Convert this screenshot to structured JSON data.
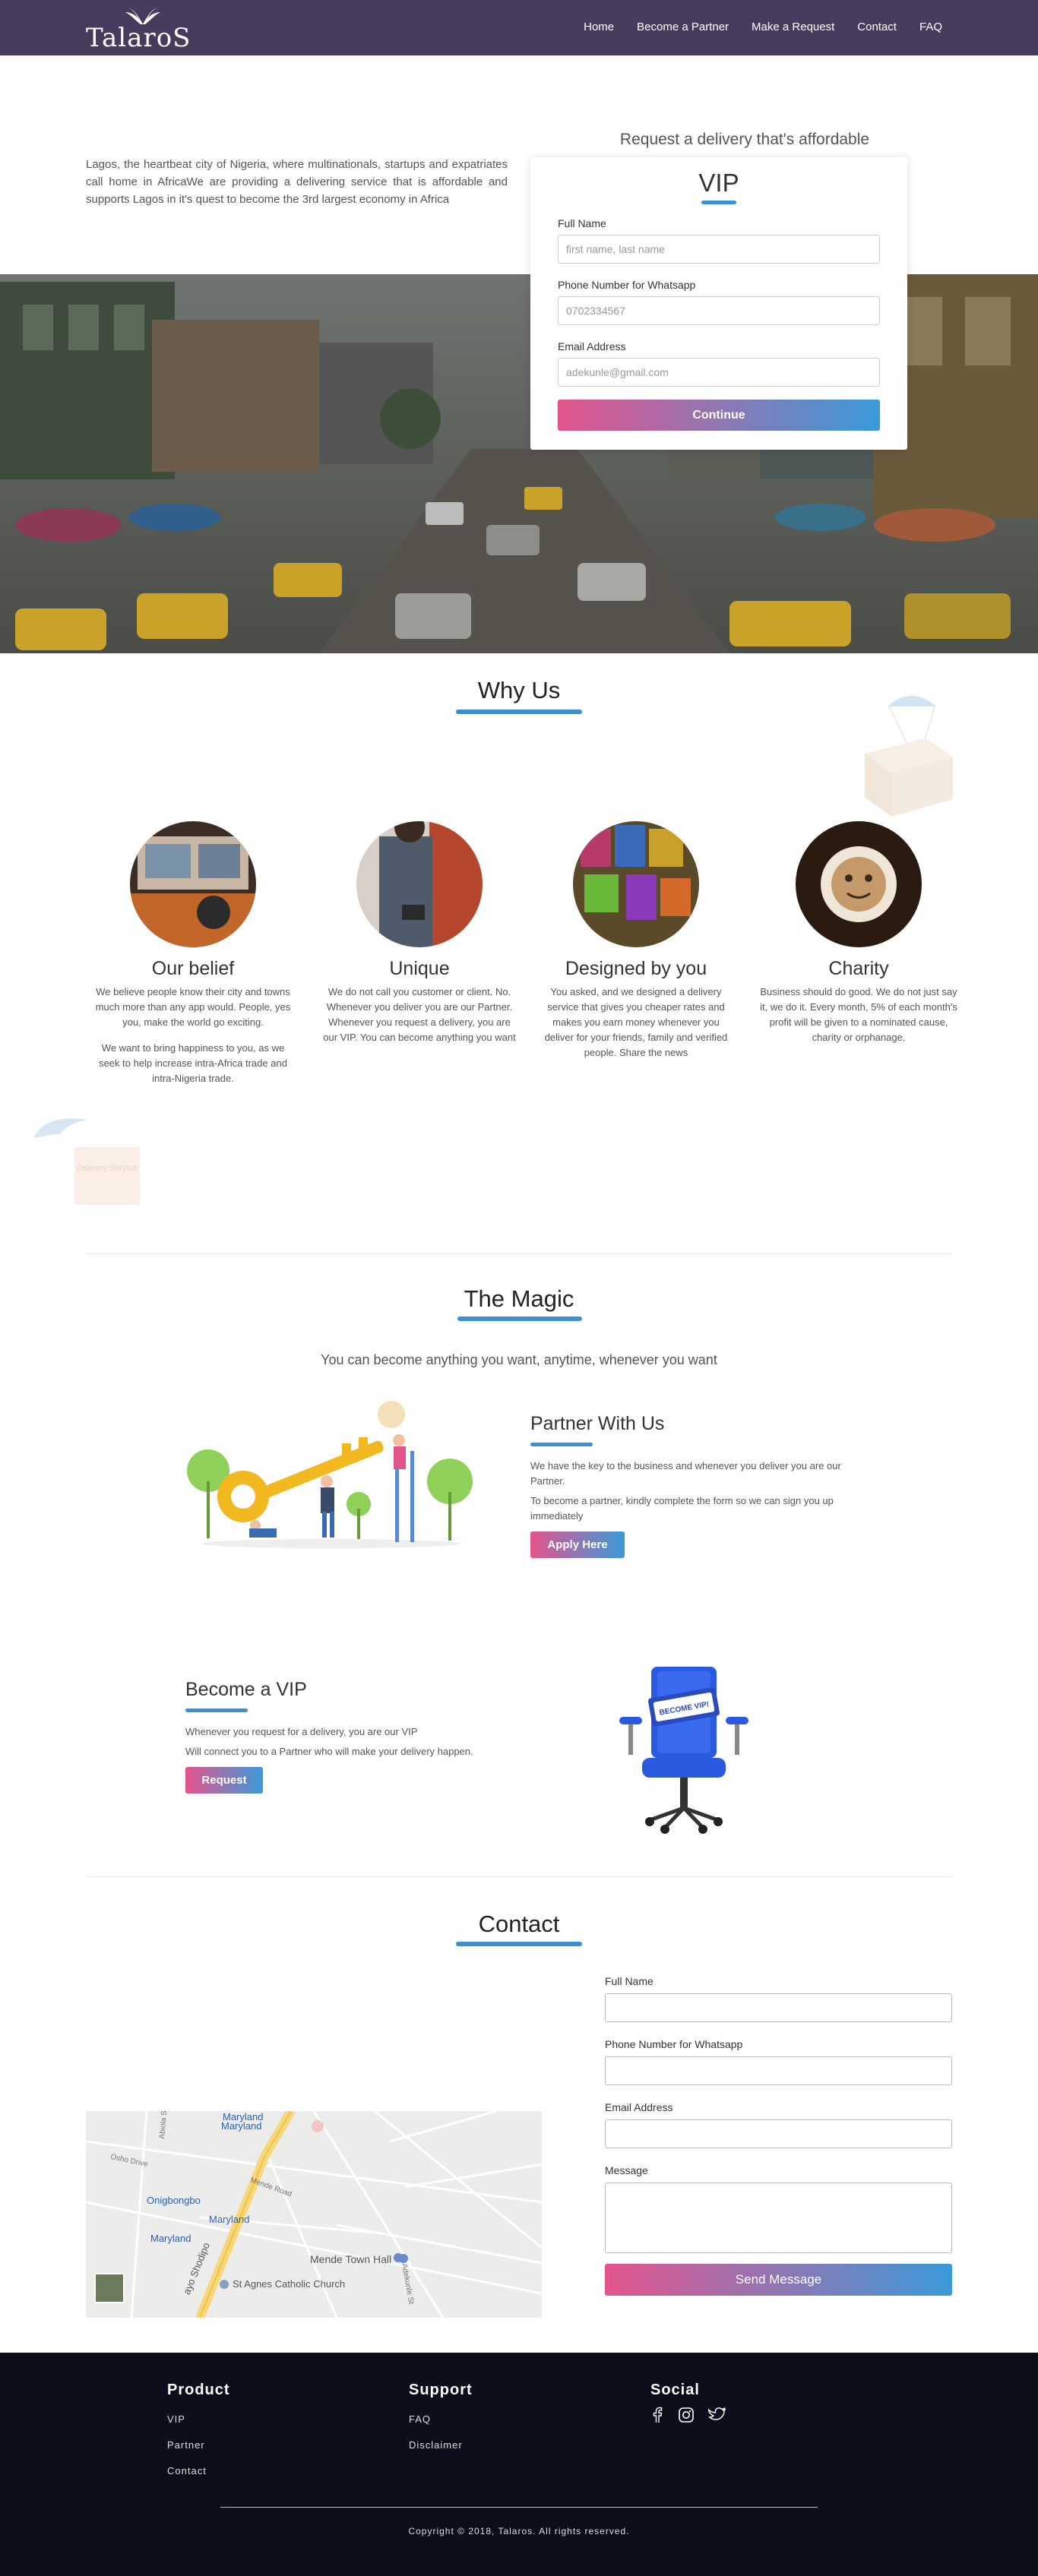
{
  "brand": {
    "name": "TalaroS"
  },
  "nav": {
    "items": [
      "Home",
      "Become a Partner",
      "Make a Request",
      "Contact",
      "FAQ"
    ]
  },
  "hero": {
    "text": "Lagos, the heartbeat city of Nigeria, where multinationals, startups and expatriates call home in AfricaWe are providing a delivering service that is affordable and supports Lagos in it's quest to become the 3rd largest economy in Africa",
    "request_title": "Request a delivery that's affordable",
    "vip": {
      "title": "VIP",
      "name_label": "Full Name",
      "name_placeholder": "first name, last name",
      "phone_label": "Phone Number for Whatsapp",
      "phone_placeholder": "0702334567",
      "email_label": "Email Address",
      "email_placeholder": "adekunle@gmail.com",
      "button": "Continue"
    }
  },
  "why": {
    "title": "Why Us",
    "features": [
      {
        "title": "Our belief",
        "text": "We believe people know their city and towns much more than any app would. People, yes you, make the world go exciting.",
        "text2": "We want to bring happiness to you, as we seek to help increase intra-Africa trade and intra-Nigeria trade."
      },
      {
        "title": "Unique",
        "text": "We do not call you customer or client. No. Whenever you deliver you are our Partner. Whenever you request a delivery, you are our VIP. You can become anything you want",
        "text2": ""
      },
      {
        "title": "Designed by you",
        "text": "You asked, and we designed a delivery service that gives you cheaper rates and makes you earn money whenever you deliver for your friends, family and verified people. Share the news",
        "text2": ""
      },
      {
        "title": "Charity",
        "text": "Business should do good. We do not just say it, we do it. Every month, 5% of each month's profit will be given to a nominated cause, charity or orphanage.",
        "text2": ""
      }
    ],
    "parcel_label": "Delivery Service"
  },
  "magic": {
    "title": "The Magic",
    "subtitle": "You can become anything you want, anytime, whenever you want",
    "partner": {
      "title": "Partner With Us",
      "text1": "We have the key to the business and whenever you deliver you are our Partner.",
      "text2": "To become a partner, kindly complete the form so we can sign you up immediately",
      "button": "Apply Here"
    },
    "vip": {
      "title": "Become a VIP",
      "text1": "Whenever you request for a delivery, you are our VIP",
      "text2": "Will connect you to a Partner who will make your delivery happen.",
      "button": "Request",
      "chair_sign": "BECOME VIP!"
    }
  },
  "contact": {
    "title": "Contact",
    "name_label": "Full Name",
    "phone_label": "Phone Number for Whatsapp",
    "email_label": "Email Address",
    "message_label": "Message",
    "button": "Send Message",
    "map_labels": {
      "maryland_top": "Maryland",
      "onigbongbo": "Onigbongbo",
      "maryland_mid": "Maryland",
      "maryland_low": "Maryland",
      "mende_town": "Mende Town Hall",
      "church": "St Agnes Catholic Church",
      "road": "ayo Shodipo",
      "osho": "Osho Drive",
      "mende_road": "Mende Road",
      "abiola": "Abiola Street",
      "adekunle": "Adekunle St"
    }
  },
  "footer": {
    "product": {
      "title": "Product",
      "links": [
        "VIP",
        "Partner",
        "Contact"
      ]
    },
    "support": {
      "title": "Support",
      "links": [
        "FAQ",
        "Disclaimer"
      ]
    },
    "social": {
      "title": "Social"
    },
    "copyright": "Copyright © 2018, Talaros. All rights reserved."
  },
  "colors": {
    "nav": "#463d5e",
    "accent": "#3a8fd6",
    "gradient_start": "#e4548c",
    "gradient_end": "#3a99d8",
    "footer": "#0b0f1c"
  }
}
